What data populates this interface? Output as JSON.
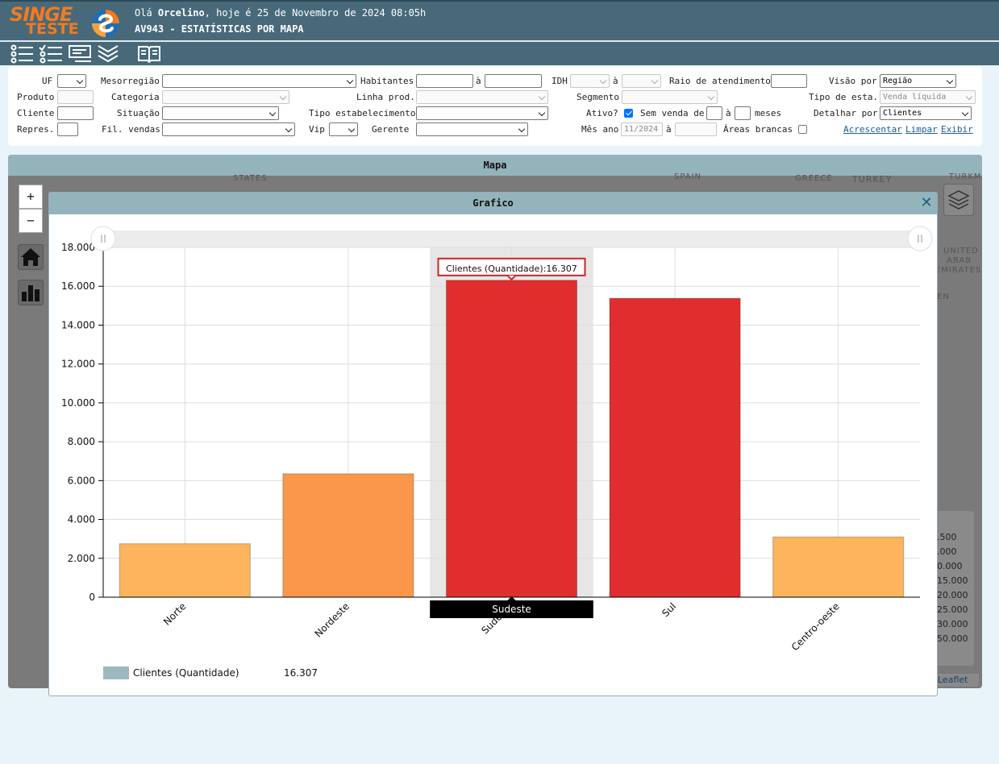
{
  "header": {
    "logo_line1": "SINGE",
    "logo_line2": "TESTE",
    "greeting_prefix": "Olá ",
    "user": "Orcelino",
    "greeting_suffix": ", hoje é 25 de Novembro de 2024 08:05h",
    "page_title": "AV943 - ESTATÍSTICAS POR MAPA"
  },
  "toolbar": {
    "icons": [
      "list-icon",
      "checklist-icon",
      "card-icon",
      "chevrons-down-icon",
      "book-icon"
    ]
  },
  "filters": {
    "uf_label": "UF",
    "mesorregiao_label": "Mesorregião",
    "habitantes_label": "Habitantes",
    "a_label": "à",
    "idh_label": "IDH",
    "raio_label": "Raio de atendimento",
    "visao_label": "Visão por",
    "visao_value": "Região",
    "produto_label": "Produto",
    "categoria_label": "Categoria",
    "linha_label": "Linha prod.",
    "segmento_label": "Segmento",
    "tipo_esta_label": "Tipo de esta.",
    "tipo_esta_value": "Venda líquida",
    "cliente_label": "Cliente",
    "situacao_label": "Situação",
    "tipo_estab_label": "Tipo estabelecimento",
    "ativo_label": "Ativo?",
    "ativo_checked": true,
    "sem_venda_label": "Sem venda de",
    "meses_label": "meses",
    "detalhar_label": "Detalhar por",
    "detalhar_value": "Clientes",
    "repres_label": "Repres.",
    "fil_vendas_label": "Fil. vendas",
    "vip_label": "Vip",
    "gerente_label": "Gerente",
    "mes_ano_label": "Mês ano",
    "mes_ano_value": "11/2024",
    "areas_label": "Áreas brancas",
    "areas_checked": false,
    "acrescentar": "Acrescentar",
    "limpar": "Limpar",
    "exibir": "Exibir"
  },
  "map": {
    "title": "Mapa",
    "zoom_in": "+",
    "zoom_out": "−",
    "labels": [
      "STATES",
      "SPAIN",
      "GREECE",
      "TURKEY",
      "TURKM",
      "UNITED",
      "ARAB",
      "EMIRATES",
      "EN"
    ],
    "legend_values": [
      ".500",
      ".000",
      "0.000",
      "15.000",
      "20.000",
      "25.000",
      "30.000",
      "50.000"
    ],
    "attribution": "Leaflet"
  },
  "chart_dialog": {
    "title": "Grafico",
    "close": "✕"
  },
  "chart_data": {
    "type": "bar",
    "categories": [
      "Norte",
      "Nordeste",
      "Sudeste",
      "Sul",
      "Centro-oeste"
    ],
    "values": [
      2750,
      6350,
      16307,
      15380,
      3100
    ],
    "colors": [
      "#fdb45c",
      "#fb974b",
      "#e12d2e",
      "#e12d2e",
      "#fdb45c"
    ],
    "ylim": [
      0,
      18000
    ],
    "yticks": [
      "0",
      "2.000",
      "4.000",
      "6.000",
      "8.000",
      "10.000",
      "12.000",
      "14.000",
      "16.000",
      "18.000"
    ],
    "series_name": "Clientes (Quantidade)",
    "legend_value": "16.307",
    "tooltip": "Clientes (Quantidade):16.307",
    "highlighted_category": "Sudeste",
    "grid": true
  }
}
